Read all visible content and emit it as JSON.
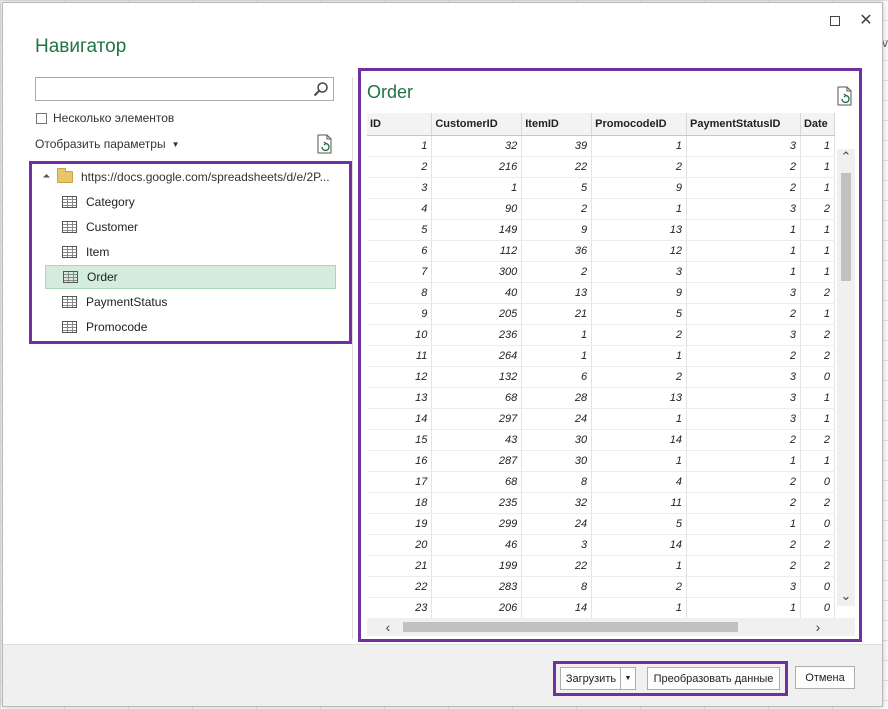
{
  "dialog": {
    "title": "Навигатор",
    "maximize_icon": "maximize-icon",
    "close_icon": "close-icon",
    "close_glyph": "✕"
  },
  "left_pane": {
    "search": {
      "value": "",
      "placeholder": ""
    },
    "multi_select_label": "Несколько элементов",
    "multi_select_checked": false,
    "display_params_label": "Отобразить параметры",
    "tree": {
      "root_label": "https://docs.google.com/spreadsheets/d/e/2P...",
      "items": [
        {
          "label": "Category",
          "selected": false
        },
        {
          "label": "Customer",
          "selected": false
        },
        {
          "label": "Item",
          "selected": false
        },
        {
          "label": "Order",
          "selected": true
        },
        {
          "label": "PaymentStatus",
          "selected": false
        },
        {
          "label": "Promocode",
          "selected": false
        }
      ]
    }
  },
  "preview": {
    "title": "Order",
    "columns": [
      "ID",
      "CustomerID",
      "ItemID",
      "PromocodeID",
      "PaymentStatusID",
      "Date"
    ],
    "rows": [
      [
        "1",
        "32",
        "39",
        "1",
        "3",
        "1"
      ],
      [
        "2",
        "216",
        "22",
        "2",
        "2",
        "1"
      ],
      [
        "3",
        "1",
        "5",
        "9",
        "2",
        "1"
      ],
      [
        "4",
        "90",
        "2",
        "1",
        "3",
        "2"
      ],
      [
        "5",
        "149",
        "9",
        "13",
        "1",
        "1"
      ],
      [
        "6",
        "112",
        "36",
        "12",
        "1",
        "1"
      ],
      [
        "7",
        "300",
        "2",
        "3",
        "1",
        "1"
      ],
      [
        "8",
        "40",
        "13",
        "9",
        "3",
        "2"
      ],
      [
        "9",
        "205",
        "21",
        "5",
        "2",
        "1"
      ],
      [
        "10",
        "236",
        "1",
        "2",
        "3",
        "2"
      ],
      [
        "11",
        "264",
        "1",
        "1",
        "2",
        "2"
      ],
      [
        "12",
        "132",
        "6",
        "2",
        "3",
        "0"
      ],
      [
        "13",
        "68",
        "28",
        "13",
        "3",
        "1"
      ],
      [
        "14",
        "297",
        "24",
        "1",
        "3",
        "1"
      ],
      [
        "15",
        "43",
        "30",
        "14",
        "2",
        "2"
      ],
      [
        "16",
        "287",
        "30",
        "1",
        "1",
        "1"
      ],
      [
        "17",
        "68",
        "8",
        "4",
        "2",
        "0"
      ],
      [
        "18",
        "235",
        "32",
        "11",
        "2",
        "2"
      ],
      [
        "19",
        "299",
        "24",
        "5",
        "1",
        "0"
      ],
      [
        "20",
        "46",
        "3",
        "14",
        "2",
        "2"
      ],
      [
        "21",
        "199",
        "22",
        "1",
        "2",
        "2"
      ],
      [
        "22",
        "283",
        "8",
        "2",
        "3",
        "0"
      ],
      [
        "23",
        "206",
        "14",
        "1",
        "1",
        "0"
      ]
    ]
  },
  "footer": {
    "load_label": "Загрузить",
    "transform_label": "Преобразовать данные",
    "cancel_label": "Отмена"
  },
  "colors": {
    "accent_green": "#217346",
    "highlight_box": "#7030a0",
    "selected_row": "#d3ecdc"
  },
  "edge_glyph": "v"
}
